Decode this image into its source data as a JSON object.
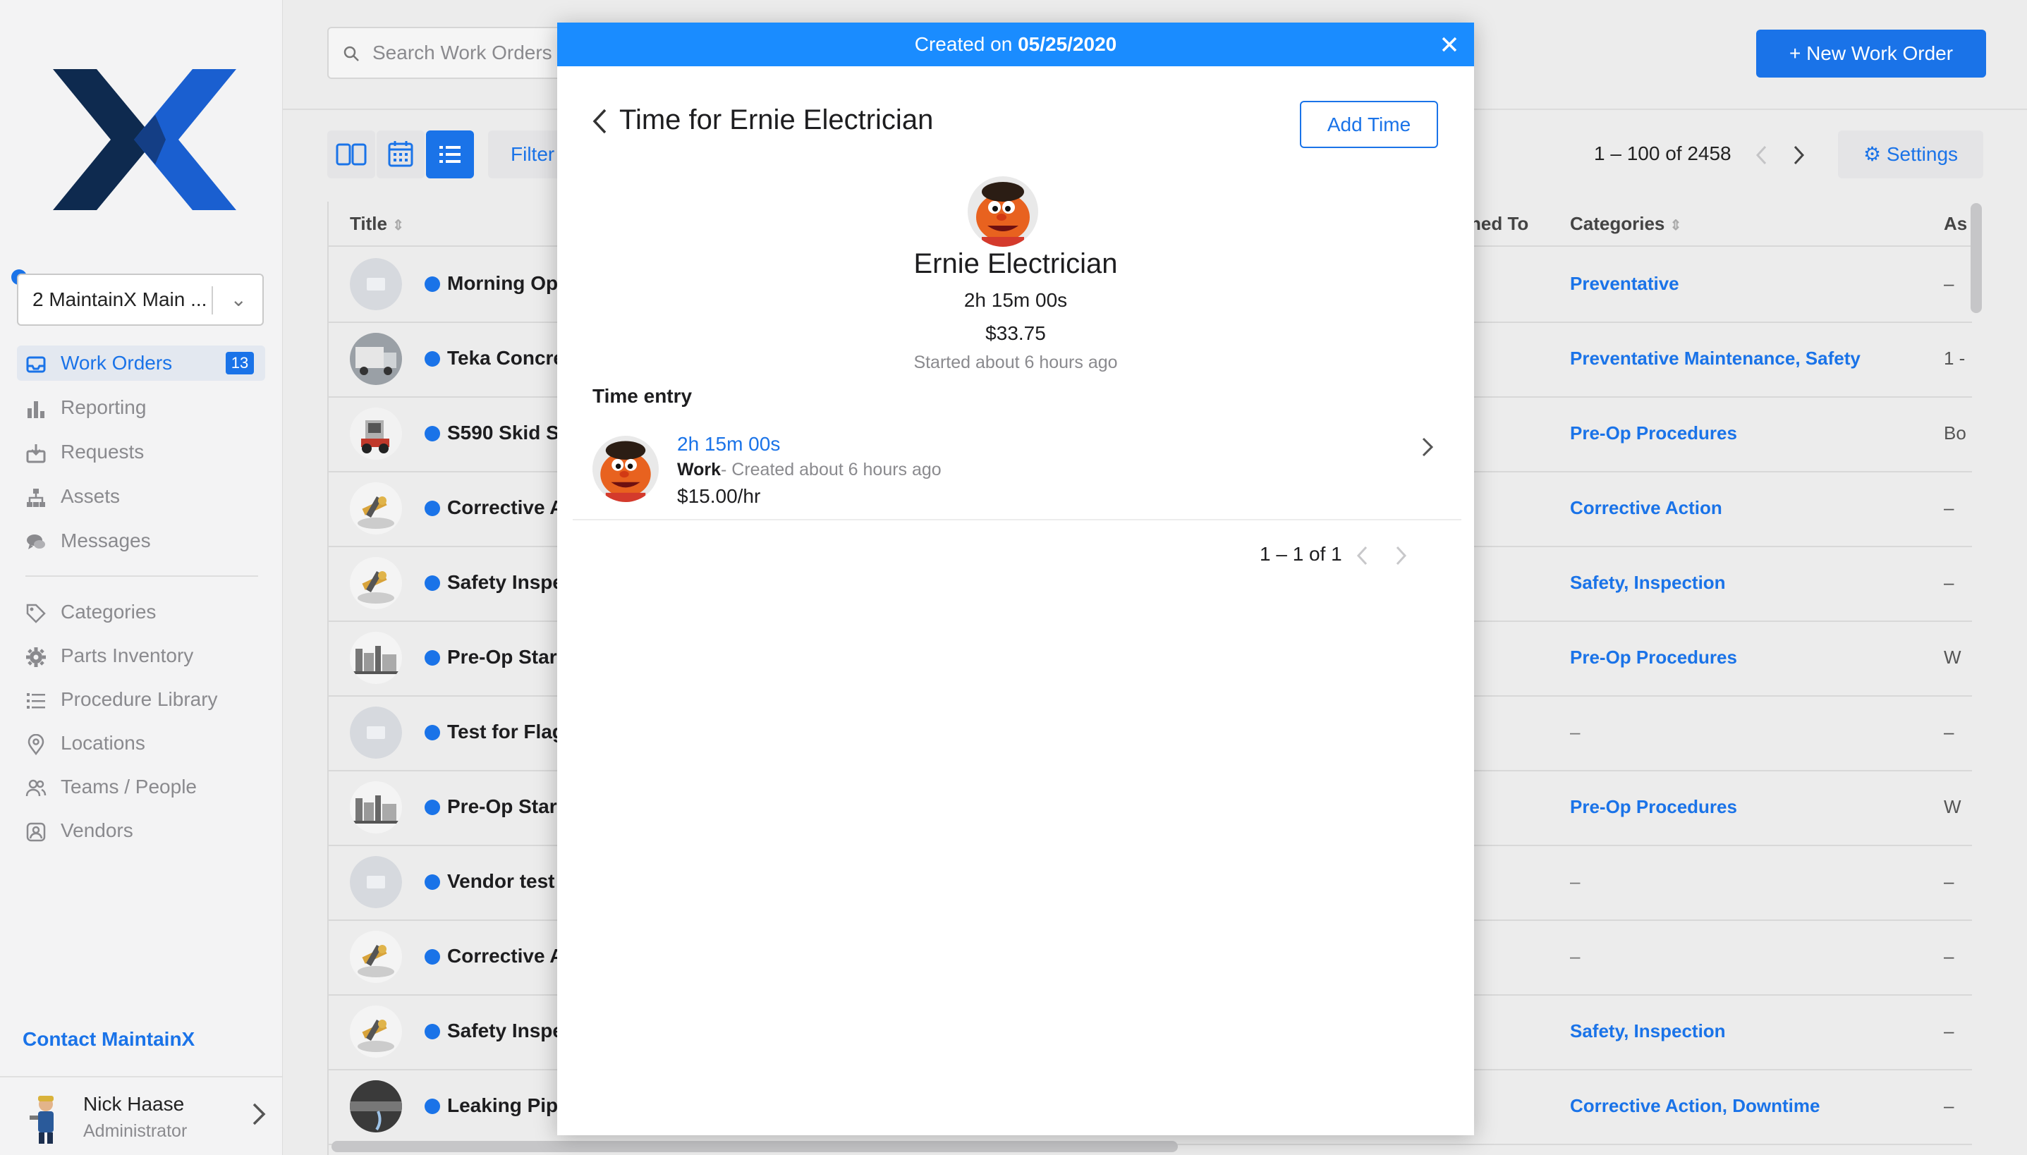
{
  "sidebar": {
    "location_select": "2 MaintainX Main ...",
    "nav_primary": [
      {
        "label": "Work Orders",
        "icon": "inbox-icon",
        "badge": "13",
        "active": true
      },
      {
        "label": "Reporting",
        "icon": "bar-chart-icon"
      },
      {
        "label": "Requests",
        "icon": "tray-download-icon"
      },
      {
        "label": "Assets",
        "icon": "hierarchy-icon"
      },
      {
        "label": "Messages",
        "icon": "chat-bubbles-icon"
      }
    ],
    "nav_secondary": [
      {
        "label": "Categories",
        "icon": "tag-icon"
      },
      {
        "label": "Parts Inventory",
        "icon": "gear-icon"
      },
      {
        "label": "Procedure Library",
        "icon": "list-icon"
      },
      {
        "label": "Locations",
        "icon": "map-pin-icon"
      },
      {
        "label": "Teams / People",
        "icon": "people-icon"
      },
      {
        "label": "Vendors",
        "icon": "vendors-icon"
      }
    ],
    "contact_link": "Contact MaintainX",
    "user": {
      "name": "Nick Haase",
      "role": "Administrator"
    }
  },
  "topbar": {
    "search_placeholder": "Search Work Orders",
    "new_work_order": "+ New Work Order"
  },
  "toolbar": {
    "filter_label": "Filter",
    "pagination": "1 – 100 of 2458",
    "settings_label": "Settings"
  },
  "table": {
    "columns": {
      "title": "Title",
      "assigned_to": "ned To",
      "categories": "Categories",
      "asset": "As"
    },
    "rows": [
      {
        "title": "Morning Op",
        "categories": "Preventative",
        "asset": "–",
        "thumb": "placeholder"
      },
      {
        "title": "Teka Concre",
        "categories": "Preventative Maintenance, Safety",
        "asset": "1 -",
        "thumb": "truck"
      },
      {
        "title": "S590 Skid S",
        "categories": "Pre-Op Procedures",
        "asset": "Bo",
        "thumb": "skid"
      },
      {
        "title": "Corrective A",
        "categories": "Corrective Action",
        "asset": "–",
        "thumb": "tools"
      },
      {
        "title": "Safety Inspe",
        "categories": "Safety, Inspection",
        "asset": "–",
        "thumb": "tools"
      },
      {
        "title": "Pre-Op Star",
        "categories": "Pre-Op Procedures",
        "asset": "W",
        "thumb": "plant"
      },
      {
        "title": "Test for Flag",
        "categories": "–",
        "asset": "–",
        "thumb": "placeholder"
      },
      {
        "title": "Pre-Op Star",
        "categories": "Pre-Op Procedures",
        "asset": "W",
        "thumb": "plant"
      },
      {
        "title": "Vendor test",
        "categories": "–",
        "asset": "–",
        "thumb": "placeholder"
      },
      {
        "title": "Corrective A",
        "categories": "–",
        "asset": "–",
        "thumb": "tools"
      },
      {
        "title": "Safety Inspe",
        "categories": "Safety, Inspection",
        "asset": "–",
        "thumb": "tools"
      },
      {
        "title": "Leaking Pip",
        "categories": "Corrective Action, Downtime",
        "asset": "–",
        "thumb": "pipe"
      }
    ]
  },
  "modal": {
    "header_prefix": "Created on ",
    "header_date": "05/25/2020",
    "title": "Time for Ernie Electrician",
    "add_time": "Add Time",
    "person": {
      "name": "Ernie Electrician",
      "duration": "2h 15m 00s",
      "cost": "$33.75",
      "started": "Started about 6 hours ago"
    },
    "section_label": "Time entry",
    "entry": {
      "duration": "2h 15m 00s",
      "type": "Work",
      "meta": " - Created about 6 hours ago",
      "rate": "$15.00/hr"
    },
    "pagination": "1 – 1 of 1"
  },
  "colors": {
    "accent": "#1a73e8",
    "modal_header": "#1a8cff",
    "logo_dark": "#0e2a4f"
  }
}
